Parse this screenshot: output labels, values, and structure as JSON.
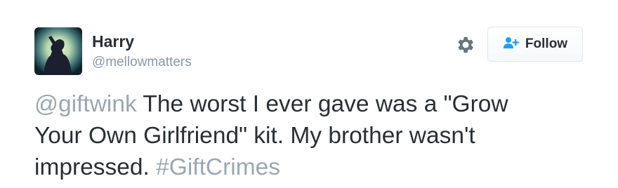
{
  "user": {
    "name": "Harry",
    "handle": "@mellowmatters"
  },
  "actions": {
    "follow_label": "Follow"
  },
  "tweet": {
    "mention": "@giftwink",
    "text_line1": " The worst I ever gave was a \"Grow",
    "text_line2": "Your Own Girlfriend\" kit. My brother wasn't",
    "text_line3": "impressed. ",
    "hashtag": "#GiftCrimes"
  },
  "colors": {
    "text": "#292f33",
    "muted": "#8899a6",
    "link": "#9aa7b3",
    "follow_icon": "#1da1f2"
  },
  "icons": {
    "settings": "gear-icon",
    "follow": "add-user-icon"
  }
}
